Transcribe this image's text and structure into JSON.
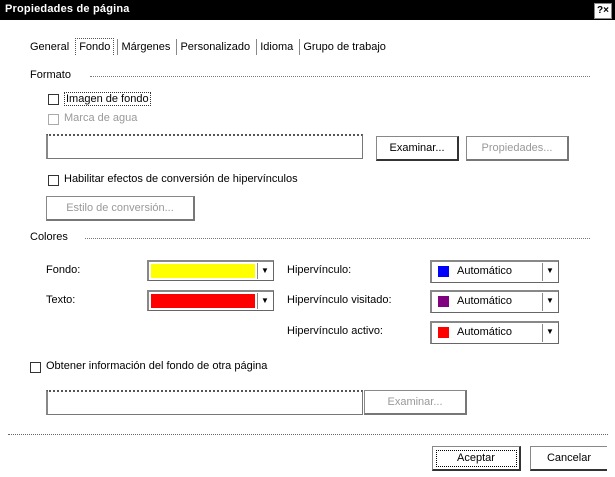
{
  "window": {
    "title": "Propiedades de página",
    "help_label": "?×"
  },
  "tabs": [
    {
      "label": "General"
    },
    {
      "label": "Fondo"
    },
    {
      "label": "Márgenes"
    },
    {
      "label": "Personalizado"
    },
    {
      "label": "Idioma"
    },
    {
      "label": "Grupo de trabajo"
    }
  ],
  "formato": {
    "group_label": "Formato",
    "imagen_fondo_label": "Imagen de fondo",
    "marca_agua_label": "Marca de agua",
    "examinar_label": "Examinar...",
    "propiedades_label": "Propiedades...",
    "habilitar_label": "Habilitar efectos de conversión de hipervínculos",
    "estilo_label": "Estilo de conversión..."
  },
  "colores": {
    "group_label": "Colores",
    "fondo_label": "Fondo:",
    "fondo_color": "#ffff00",
    "texto_label": "Texto:",
    "texto_color": "#ff0000",
    "hipervinculo_label": "Hipervínculo:",
    "hipervinculo_value": "Automático",
    "hipervinculo_color": "#0000ff",
    "visitado_label": "Hipervínculo visitado:",
    "visitado_value": "Automático",
    "visitado_color": "#800080",
    "activo_label": "Hipervínculo activo:",
    "activo_value": "Automático",
    "activo_color": "#ff0000"
  },
  "obtener": {
    "label": "Obtener información del fondo de otra página",
    "examinar_label": "Examinar..."
  },
  "footer": {
    "aceptar_label": "Aceptar",
    "cancelar_label": "Cancelar"
  }
}
